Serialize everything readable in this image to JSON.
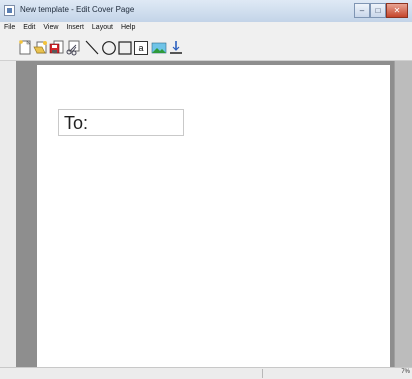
{
  "window": {
    "title": "New template - Edit Cover Page",
    "controls": [
      "minimize",
      "maximize",
      "close"
    ]
  },
  "menu": [
    "File",
    "Edit",
    "View",
    "Insert",
    "Layout",
    "Help"
  ],
  "toolbar": {
    "tools": [
      "new-page-icon",
      "open-icon",
      "save-icon",
      "cut-icon",
      "line-tool-icon",
      "ellipse-tool-icon",
      "rectangle-tool-icon",
      "text-tool-icon",
      "image-tool-icon",
      "anchor-tool-icon"
    ],
    "text_tool_glyph": "a"
  },
  "page": {
    "text_box_value": "To:"
  },
  "status": {
    "text": "7%"
  }
}
